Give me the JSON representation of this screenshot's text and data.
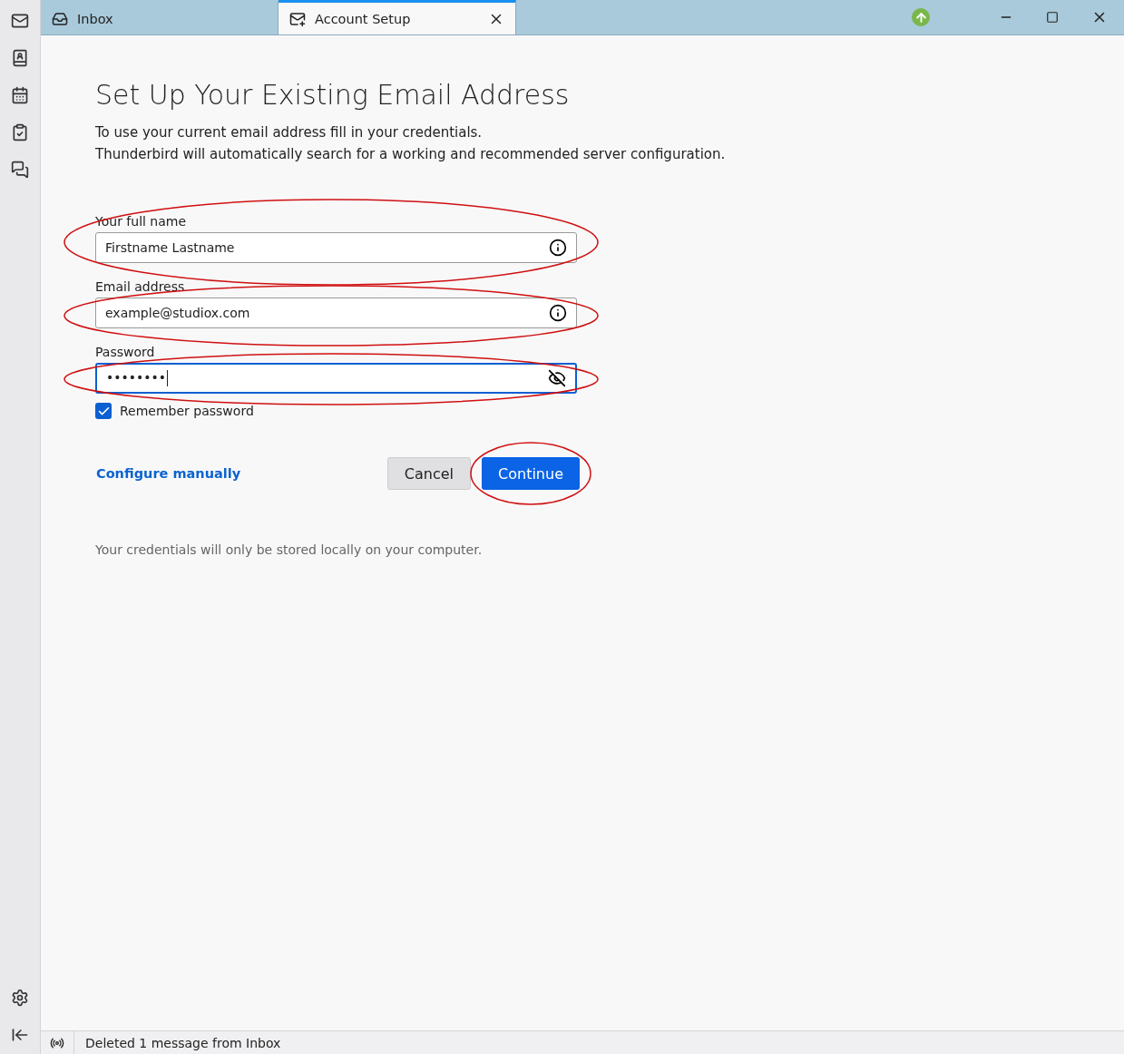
{
  "tabs": [
    {
      "label": "Inbox",
      "kind": "inbox",
      "selected": false,
      "closable": false
    },
    {
      "label": "Account Setup",
      "kind": "setup",
      "selected": true,
      "closable": true
    }
  ],
  "heading": "Set Up Your Existing Email Address",
  "intro": [
    "To use your current email address fill in your credentials.",
    "Thunderbird will automatically search for a working and recommended server configuration."
  ],
  "fields": [
    {
      "label": "Your full name",
      "value": "Firstname Lastname",
      "kind": "info",
      "focused": false,
      "highlighted": true
    },
    {
      "label": "Email address",
      "value": "example@studiox.com",
      "kind": "info",
      "focused": false,
      "highlighted": true
    },
    {
      "label": "Password",
      "value": "••••••••",
      "kind": "password",
      "focused": true,
      "highlighted": true
    }
  ],
  "remember": {
    "label": "Remember password",
    "checked": true
  },
  "link": "Configure manually",
  "buttons": [
    {
      "label": "Cancel",
      "primary": false,
      "highlighted": false
    },
    {
      "label": "Continue",
      "primary": true,
      "highlighted": true
    }
  ],
  "note": "Your credentials will only be stored locally on your computer.",
  "status_bar": {
    "text": "Deleted 1 message from Inbox"
  }
}
